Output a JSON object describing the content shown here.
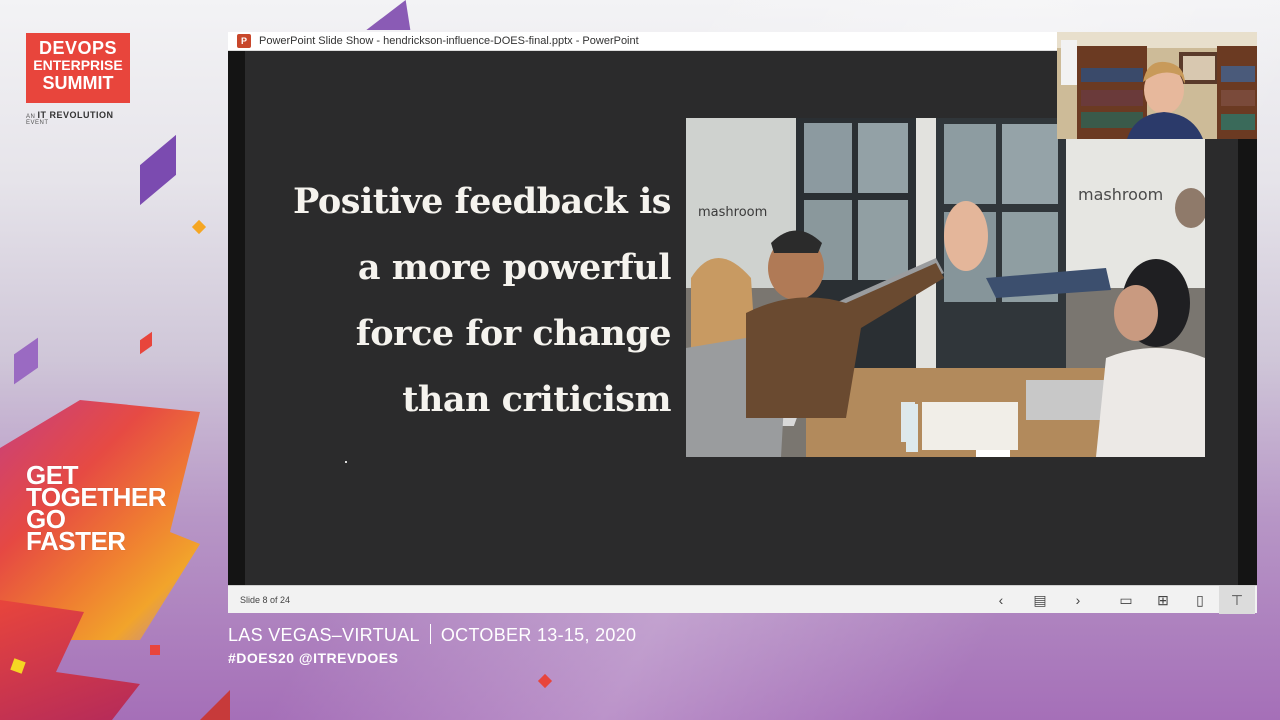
{
  "event": {
    "logo_line1": "DEVOPS",
    "logo_line2": "ENTERPRISE",
    "logo_line3": "SUMMIT",
    "logo_sub_prefix": "AN",
    "logo_sub_brand": "IT REVOLUTION",
    "logo_sub_suffix": "EVENT",
    "tagline": [
      "GET",
      "TOGETHER",
      "GO",
      "FASTER"
    ],
    "location": "LAS VEGAS–VIRTUAL",
    "dates": "OCTOBER 13-15, 2020",
    "hashtags": "#DOES20  @ITREVDOES"
  },
  "window": {
    "app_icon": "powerpoint-icon",
    "title": "PowerPoint Slide Show  -  hendrickson-influence-DOES-final.pptx - PowerPoint"
  },
  "slide": {
    "quote_lines": [
      "Positive feedback is",
      "a more powerful",
      "force for change",
      "than criticism"
    ],
    "photo_sign_left": "mashroom",
    "photo_sign_right": "mashroom"
  },
  "statusbar": {
    "slide_counter": "Slide 8 of 24",
    "buttons": [
      {
        "name": "previous-slide-button",
        "icon": "chevron-left-icon",
        "glyph": "‹"
      },
      {
        "name": "slide-sorter-toggle-button",
        "icon": "slides-icon",
        "glyph": "▤"
      },
      {
        "name": "next-slide-button",
        "icon": "chevron-right-icon",
        "glyph": "›"
      },
      {
        "name": "normal-view-button",
        "icon": "normal-view-icon",
        "glyph": "▭"
      },
      {
        "name": "slide-sorter-view-button",
        "icon": "grid-icon",
        "glyph": "⊞"
      },
      {
        "name": "reading-view-button",
        "icon": "book-icon",
        "glyph": "▯"
      },
      {
        "name": "slide-show-view-button",
        "icon": "projector-icon",
        "glyph": "⊤"
      }
    ]
  },
  "colors": {
    "brand_red": "#e8453c",
    "slide_bg": "#2b2b2c",
    "slide_text": "#f5f3ee",
    "footer_text": "#ffffff"
  }
}
